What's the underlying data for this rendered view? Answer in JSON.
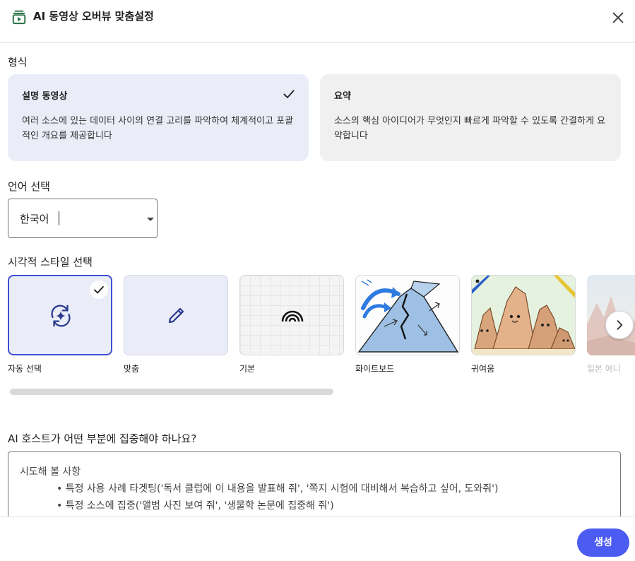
{
  "header": {
    "title": "AI 동영상 오버뷰 맞춤설정",
    "app_icon": "video-library-icon",
    "close_icon": "close-icon"
  },
  "format": {
    "label": "형식",
    "options": [
      {
        "title": "설명 동영상",
        "desc": "여러 소스에 있는 데이터 사이의 연결 고리를 파악하여 체계적이고 포괄적인 개요를 제공합니다",
        "selected": true
      },
      {
        "title": "요약",
        "desc": "소스의 핵심 아이디어가 무엇인지 빠르게 파악할 수 있도록 간결하게 요약합니다",
        "selected": false
      }
    ]
  },
  "language": {
    "label": "언어 선택",
    "value": "한국어"
  },
  "visual_style": {
    "label": "시각적 스타일 선택",
    "options": [
      {
        "label": "자동 선택",
        "icon": "auto-awesome-icon",
        "selected": true
      },
      {
        "label": "맞춤",
        "icon": "pencil-icon",
        "selected": false
      },
      {
        "label": "기본",
        "icon": "rainbow-icon",
        "selected": false
      },
      {
        "label": "화이트보드",
        "icon": "volcano-sketch-thumbnail",
        "selected": false
      },
      {
        "label": "귀여움",
        "icon": "cute-rocks-thumbnail",
        "selected": false
      },
      {
        "label": "일본 애니",
        "icon": "anime-landscape-thumbnail",
        "selected": false
      }
    ],
    "next_icon": "chevron-right-icon"
  },
  "focus": {
    "label": "AI 호스트가 어떤 부분에 집중해야 하나요?",
    "placeholder_title": "시도해 볼 사항",
    "suggestions": [
      "특정 사용 사례 타겟팅('독서 클럽에 이 내용을 발표해 줘', '쪽지 시험에 대비해서 복습하고 싶어, 도와줘')",
      "특정 소스에 집중('앨범 사진 보여 줘', '생물학 논문에 집중해 줘')"
    ]
  },
  "actions": {
    "generate_label": "생성"
  },
  "colors": {
    "accent": "#4c5cf2",
    "selected_bg": "#eaedf8",
    "selected_border": "#3c4fd6"
  }
}
